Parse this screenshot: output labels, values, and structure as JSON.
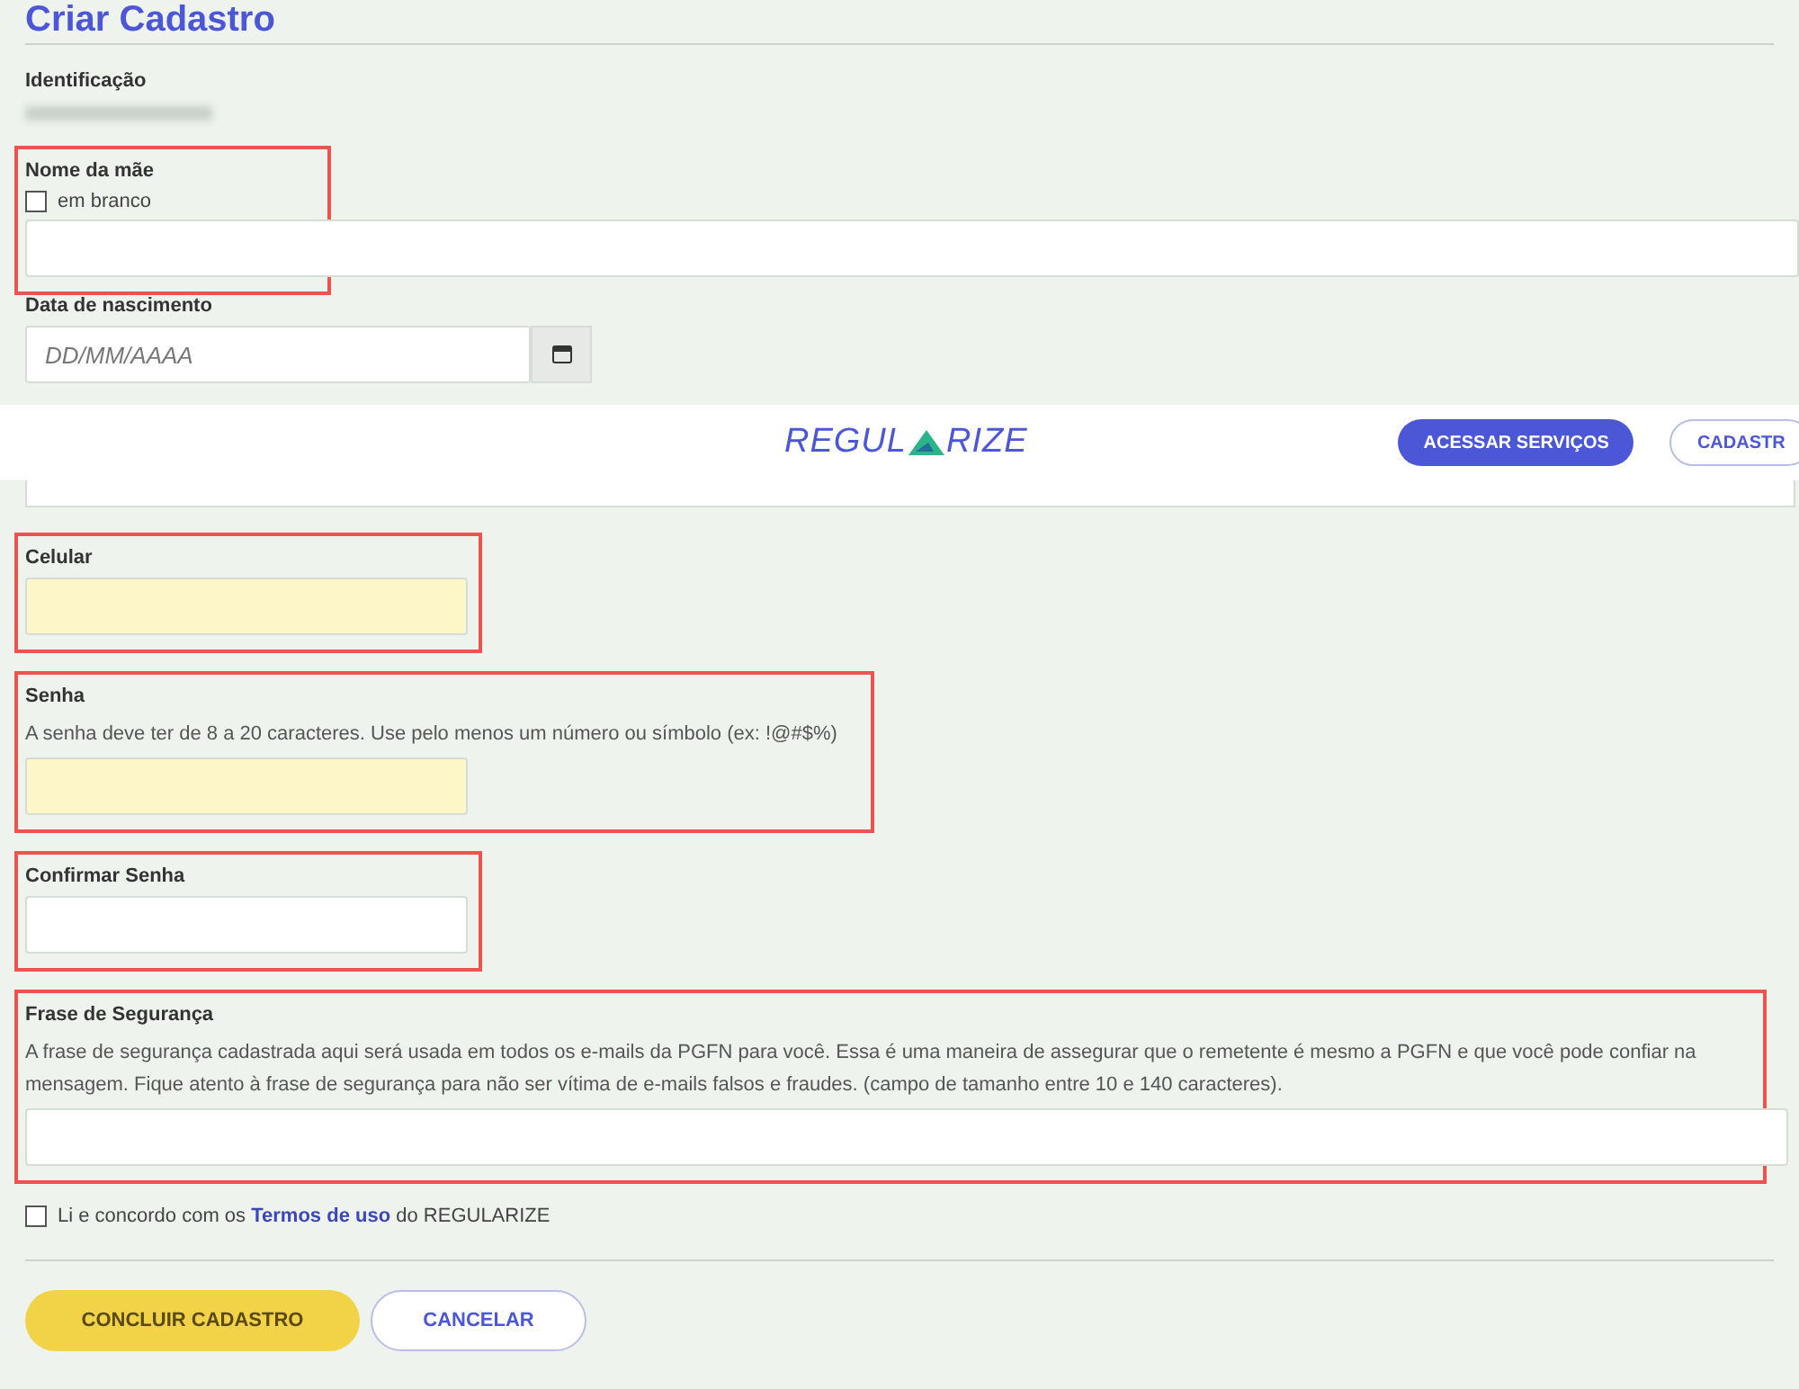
{
  "title": "Criar Cadastro",
  "identification": {
    "label": "Identificação"
  },
  "sections": [
    {
      "kind": "mother",
      "label": "Nome da mãe",
      "highlighted": true,
      "checkbox": {
        "label": "em branco",
        "checked": false
      }
    },
    {
      "kind": "date",
      "label": "Data de nascimento",
      "placeholder": "DD/MM/AAAA",
      "highlighted": false
    },
    {
      "kind": "banner",
      "logo": {
        "before": "REGUL",
        "after": "RIZE"
      },
      "buttons": [
        {
          "label": "ACESSAR SERVIÇOS",
          "primary": true
        },
        {
          "label": "CADASTR",
          "primary": false
        }
      ]
    },
    {
      "kind": "input",
      "label": "Celular",
      "highlighted": true,
      "autofilled": true,
      "wide": false
    },
    {
      "kind": "input",
      "label": "Senha",
      "hint": "A senha deve ter de 8 a 20 caracteres. Use pelo menos um número ou símbolo (ex: !@#$%)",
      "highlighted": true,
      "autofilled": true,
      "wide": false
    },
    {
      "kind": "input",
      "label": "Confirmar Senha",
      "highlighted": true,
      "autofilled": false,
      "wide": false
    },
    {
      "kind": "input",
      "label": "Frase de Segurança",
      "hint": "A frase de segurança cadastrada aqui será usada em todos os e-mails da PGFN para você. Essa é uma maneira de assegurar que o remetente é mesmo a PGFN e que você pode confiar na mensagem. Fique atento à frase de segurança para não ser vítima de e-mails falsos e fraudes. (campo de tamanho entre 10 e 140 caracteres).",
      "highlighted": true,
      "autofilled": false,
      "wide": true
    }
  ],
  "terms": {
    "checked": false,
    "before": "Li e concordo com os",
    "link": "Termos de uso",
    "after": "do REGULARIZE"
  },
  "actions": [
    {
      "label": "CONCLUIR CADASTRO",
      "primary": true
    },
    {
      "label": "CANCELAR",
      "primary": false
    }
  ]
}
